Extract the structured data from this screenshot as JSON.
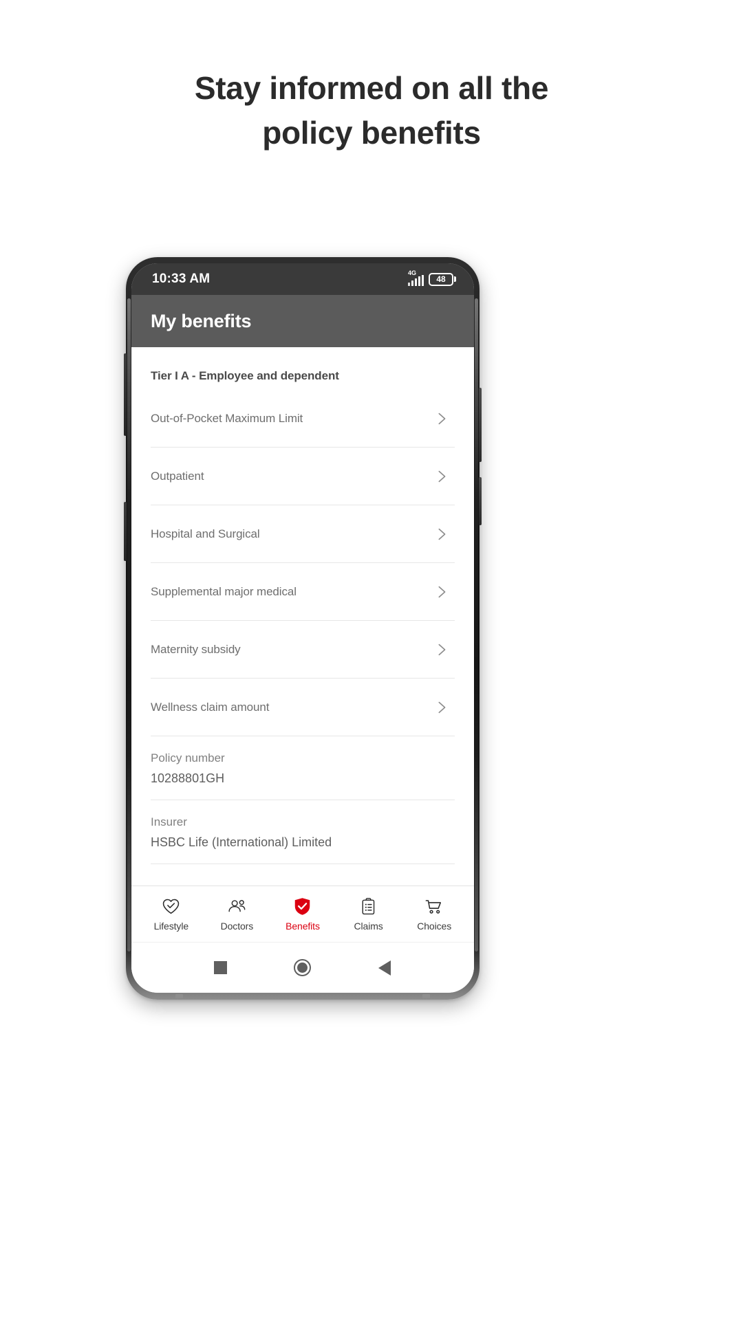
{
  "marketing": {
    "headline_line1": "Stay informed  on all the",
    "headline_line2": "policy benefits"
  },
  "status_bar": {
    "time": "10:33 AM",
    "network": "4G",
    "battery_level": "48"
  },
  "app_header": {
    "title": "My benefits"
  },
  "content": {
    "tier_title": "Tier I A - Employee and dependent",
    "benefit_rows": [
      {
        "label": "Out-of-Pocket Maximum Limit",
        "icon": "chevron-right-icon"
      },
      {
        "label": "Outpatient",
        "icon": "chevron-right-icon"
      },
      {
        "label": "Hospital and Surgical",
        "icon": "chevron-right-icon"
      },
      {
        "label": "Supplemental major medical",
        "icon": "chevron-right-icon"
      },
      {
        "label": "Maternity subsidy",
        "icon": "chevron-right-icon"
      },
      {
        "label": "Wellness claim amount",
        "icon": "chevron-right-icon"
      }
    ],
    "info_rows": [
      {
        "label": "Policy number",
        "value": "10288801GH"
      },
      {
        "label": "Insurer",
        "value": "HSBC Life (International) Limited"
      }
    ]
  },
  "tab_bar": {
    "active_color": "#db0011",
    "tabs": [
      {
        "label": "Lifestyle",
        "icon": "heart-check-icon",
        "active": false
      },
      {
        "label": "Doctors",
        "icon": "doctors-icon",
        "active": false
      },
      {
        "label": "Benefits",
        "icon": "shield-check-icon",
        "active": true
      },
      {
        "label": "Claims",
        "icon": "clipboard-list-icon",
        "active": false
      },
      {
        "label": "Choices",
        "icon": "shopping-cart-icon",
        "active": false
      }
    ]
  },
  "nav_bar": {
    "recents": "square-recents-icon",
    "home": "circle-home-icon",
    "back": "triangle-back-icon"
  }
}
